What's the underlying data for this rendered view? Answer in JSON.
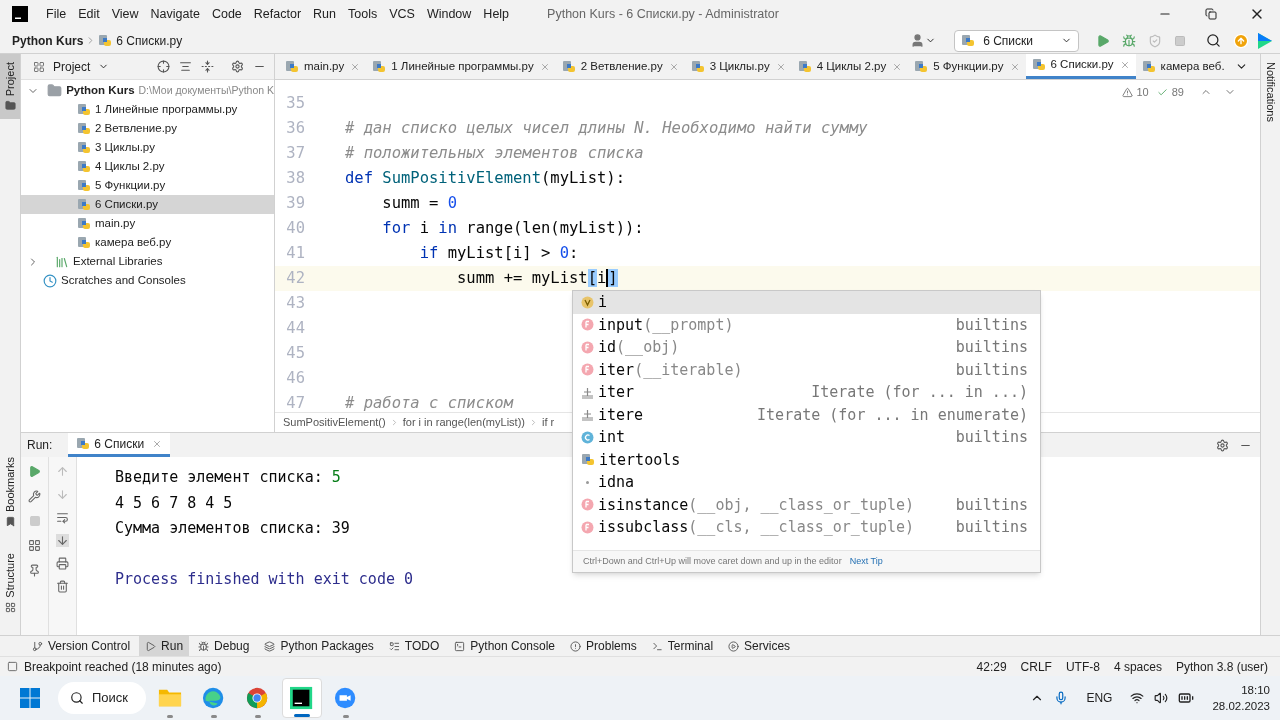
{
  "window": {
    "title": "Python Kurs - 6 Списки.py - Administrator"
  },
  "menu": [
    "File",
    "Edit",
    "View",
    "Navigate",
    "Code",
    "Refactor",
    "Run",
    "Tools",
    "VCS",
    "Window",
    "Help"
  ],
  "breadcrumb": [
    "Python Kurs",
    "6 Списки.py"
  ],
  "run_config": "6 Списки",
  "side_left": [
    "Project",
    "Bookmarks",
    "Structure"
  ],
  "side_right": [
    "Notifications"
  ],
  "project": {
    "title": "Project",
    "tree": [
      {
        "kind": "folder",
        "label": "Python Kurs",
        "path": "D:\\Мои документы\\Python K",
        "expanded": true,
        "selected": false,
        "children": [
          {
            "kind": "file",
            "label": "1 Линейные программы.py",
            "selected": false
          },
          {
            "kind": "file",
            "label": "2 Ветвление.py",
            "selected": false
          },
          {
            "kind": "file",
            "label": "3 Циклы.py",
            "selected": false
          },
          {
            "kind": "file",
            "label": "4 Циклы 2.py",
            "selected": false
          },
          {
            "kind": "file",
            "label": "5 Функции.py",
            "selected": false
          },
          {
            "kind": "file",
            "label": "6 Списки.py",
            "selected": true
          },
          {
            "kind": "file",
            "label": "main.py",
            "selected": false
          },
          {
            "kind": "file",
            "label": "камера веб.py",
            "selected": false
          }
        ]
      },
      {
        "kind": "libraries",
        "label": "External Libraries",
        "expanded": false,
        "selected": false
      },
      {
        "kind": "scratches",
        "label": "Scratches and Consoles",
        "selected": false
      }
    ]
  },
  "tabs": [
    {
      "label": "main.py",
      "selected": false
    },
    {
      "label": "1 Линейные программы.py",
      "selected": false
    },
    {
      "label": "2 Ветвление.py",
      "selected": false
    },
    {
      "label": "3 Циклы.py",
      "selected": false
    },
    {
      "label": "4 Циклы 2.py",
      "selected": false
    },
    {
      "label": "5 Функции.py",
      "selected": false
    },
    {
      "label": "6 Списки.py",
      "selected": true
    },
    {
      "label": "камера веб.",
      "selected": false
    }
  ],
  "inspections": {
    "warnings": "10",
    "ok": "89"
  },
  "code": [
    {
      "number": "35",
      "current": false
    },
    {
      "number": "36",
      "current": false,
      "segments": [
        {
          "kind": "comment",
          "text": "# дан списко целых чисел длины N. Необходимо найти сумму"
        }
      ]
    },
    {
      "number": "37",
      "current": false,
      "segments": [
        {
          "kind": "comment",
          "text": "# положительных элементов списка"
        }
      ]
    },
    {
      "number": "38",
      "current": false,
      "segments": [
        {
          "kind": "keyword",
          "text": "def"
        },
        {
          "kind": "function",
          "text": " SumPositivElement"
        },
        {
          "kind": "plain",
          "text": "(myList):"
        }
      ]
    },
    {
      "number": "39",
      "current": false,
      "segments": [
        {
          "kind": "plain",
          "text": "    summ = "
        },
        {
          "kind": "number",
          "text": "0"
        }
      ]
    },
    {
      "number": "40",
      "current": false,
      "segments": [
        {
          "kind": "keyword",
          "text": "    for"
        },
        {
          "kind": "plain",
          "text": " i "
        },
        {
          "kind": "keyword",
          "text": "in"
        },
        {
          "kind": "plain",
          "text": " range(len(myList)):"
        }
      ]
    },
    {
      "number": "41",
      "current": false,
      "segments": [
        {
          "kind": "keyword",
          "text": "        if"
        },
        {
          "kind": "plain",
          "text": " myList[i] > "
        },
        {
          "kind": "number",
          "text": "0"
        },
        {
          "kind": "plain",
          "text": ":"
        }
      ]
    },
    {
      "number": "42",
      "current": true,
      "segments": [
        {
          "kind": "plain",
          "text": "            summ += myList"
        },
        {
          "kind": "match",
          "text": "["
        },
        {
          "kind": "caret",
          "text": "i"
        },
        {
          "kind": "match",
          "text": "]"
        }
      ]
    },
    {
      "number": "43",
      "current": false
    },
    {
      "number": "44",
      "current": false
    },
    {
      "number": "45",
      "current": false
    },
    {
      "number": "46",
      "current": false
    },
    {
      "number": "47",
      "current": false,
      "segments": [
        {
          "kind": "comment",
          "text": "# работа с списком"
        }
      ]
    }
  ],
  "code_path": [
    "SumPositivElement()",
    "for i in range(len(myList))",
    "if r"
  ],
  "completion": {
    "items": [
      {
        "kind": "variable",
        "name": "i",
        "selected": true
      },
      {
        "kind": "function",
        "name": "input",
        "params": "(__prompt)",
        "source": "builtins",
        "selected": false
      },
      {
        "kind": "function",
        "name": "id",
        "params": "(__obj)",
        "source": "builtins",
        "selected": false
      },
      {
        "kind": "function",
        "name": "iter",
        "params": "(__iterable)",
        "source": "builtins",
        "selected": false
      },
      {
        "kind": "template",
        "name": "iter",
        "source": "Iterate (for ... in ...)",
        "selected": false
      },
      {
        "kind": "template",
        "name": "itere",
        "source": "Iterate (for ... in enumerate)",
        "selected": false
      },
      {
        "kind": "class",
        "name": "int",
        "source": "builtins",
        "selected": false
      },
      {
        "kind": "package",
        "name": "itertools",
        "selected": false
      },
      {
        "kind": "module",
        "name": "idna",
        "selected": false
      },
      {
        "kind": "function",
        "name": "isinstance",
        "params": "(__obj, __class_or_tuple)",
        "source": "builtins",
        "selected": false
      },
      {
        "kind": "function",
        "name": "issubclass",
        "params": "(__cls, __class_or_tuple)",
        "source": "builtins",
        "selected": false
      }
    ],
    "hint": "Ctrl+Down and Ctrl+Up will move caret down and up in the editor",
    "tip_link": "Next Tip"
  },
  "run": {
    "label": "Run:",
    "tab": "6 Списки",
    "output": [
      {
        "kind": "line",
        "segments": [
          {
            "kind": "output",
            "text": "Введите элемент списка: "
          },
          {
            "kind": "input",
            "text": "5"
          }
        ]
      },
      {
        "kind": "line",
        "segments": [
          {
            "kind": "output",
            "text": "4 5 6 7 8 4 5"
          }
        ]
      },
      {
        "kind": "line",
        "segments": [
          {
            "kind": "output",
            "text": "Сумма элементов списка: 39"
          }
        ]
      },
      {
        "kind": "blank"
      },
      {
        "kind": "line",
        "segments": [
          {
            "kind": "system",
            "text": "Process finished with exit code 0"
          }
        ]
      }
    ]
  },
  "tool_tabs": [
    {
      "label": "Version Control",
      "selected": false
    },
    {
      "label": "Run",
      "selected": true
    },
    {
      "label": "Debug",
      "selected": false
    },
    {
      "label": "Python Packages",
      "selected": false
    },
    {
      "label": "TODO",
      "selected": false
    },
    {
      "label": "Python Console",
      "selected": false
    },
    {
      "label": "Problems",
      "selected": false
    },
    {
      "label": "Terminal",
      "selected": false
    },
    {
      "label": "Services",
      "selected": false
    }
  ],
  "status_bar": {
    "message": "Breakpoint reached (18 minutes ago)",
    "items": [
      "42:29",
      "CRLF",
      "UTF-8",
      "4 spaces",
      "Python 3.8 (user)"
    ]
  },
  "taskbar": {
    "search": "Поиск",
    "apps": [
      {
        "kind": "explorer",
        "active": false
      },
      {
        "kind": "edge",
        "active": false
      },
      {
        "kind": "chrome",
        "active": false
      },
      {
        "kind": "pycharm",
        "active": true
      },
      {
        "kind": "zoom",
        "active": false
      }
    ],
    "language": "ENG",
    "time": "18:10",
    "date": "28.02.2023"
  }
}
